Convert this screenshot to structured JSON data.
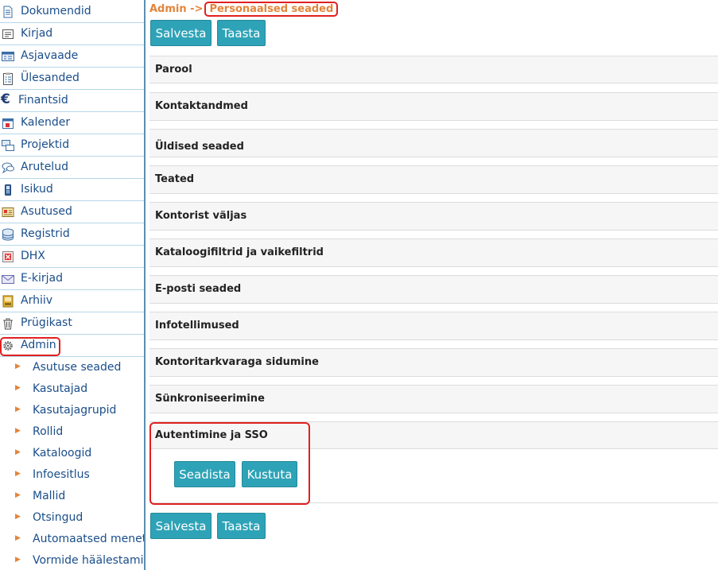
{
  "sidebar": {
    "items": [
      {
        "label": "Dokumendid",
        "icon": "document-icon"
      },
      {
        "label": "Kirjad",
        "icon": "letter-icon"
      },
      {
        "label": "Asjavaade",
        "icon": "case-view-icon"
      },
      {
        "label": "Ülesanded",
        "icon": "tasks-icon"
      },
      {
        "label": "Finantsid",
        "icon": "euro-icon"
      },
      {
        "label": "Kalender",
        "icon": "calendar-icon"
      },
      {
        "label": "Projektid",
        "icon": "projects-icon"
      },
      {
        "label": "Arutelud",
        "icon": "discussion-icon"
      },
      {
        "label": "Isikud",
        "icon": "person-icon"
      },
      {
        "label": "Asutused",
        "icon": "institution-icon"
      },
      {
        "label": "Registrid",
        "icon": "database-icon"
      },
      {
        "label": "DHX",
        "icon": "dhx-icon"
      },
      {
        "label": "E-kirjad",
        "icon": "email-icon"
      },
      {
        "label": "Arhiiv",
        "icon": "archive-icon"
      },
      {
        "label": "Prügikast",
        "icon": "trash-icon"
      },
      {
        "label": "Admin",
        "icon": "gear-icon"
      }
    ],
    "sub_items": [
      "Asutuse seaded",
      "Kasutajad",
      "Kasutajagrupid",
      "Rollid",
      "Kataloogid",
      "Infoesitlus",
      "Mallid",
      "Otsingud",
      "Automaatsed menetlused",
      "Vormide häälestamine"
    ]
  },
  "main": {
    "breadcrumb": {
      "parent": "Admin",
      "separator": "->",
      "current": "Personaalsed seaded"
    },
    "buttons": {
      "save": "Salvesta",
      "restore": "Taasta"
    },
    "sections": [
      "Parool",
      "Kontaktandmed",
      "Üldised seaded",
      "Teated",
      "Kontorist väljas",
      "Kataloogifiltrid ja vaikefiltrid",
      "E-posti seaded",
      "Infotellimused",
      "Kontoritarkvaraga sidumine",
      "Sünkroniseerimine",
      "Autentimine ja SSO"
    ],
    "auth_buttons": {
      "setup": "Seadista",
      "delete": "Kustuta"
    }
  },
  "colors": {
    "accent": "#2ea3b7",
    "link": "#1a4e8a",
    "breadcrumb": "#e3843a",
    "highlight": "#e02020"
  }
}
